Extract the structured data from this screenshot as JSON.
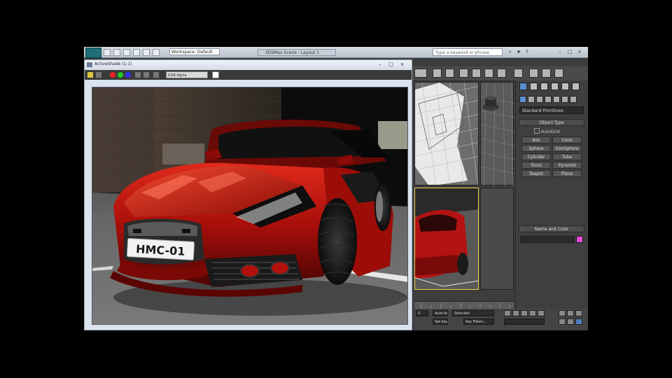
{
  "app": {
    "workspace": "Workspace: Default",
    "background_window_title": "3DSMax Scene - Layout 1",
    "search_placeholder": "Type a keyword or phrase"
  },
  "title_controls": {
    "minimize": "–",
    "maximize": "□",
    "close": "×"
  },
  "render_window": {
    "title": "ActiveShade (1:1)",
    "channel": "RGB Alpha",
    "license_plate": "HMC-01"
  },
  "command_panel": {
    "category": "Standard Primitives",
    "object_type_header": "Object Type",
    "autogrid": "AutoGrid",
    "buttons": [
      "Box",
      "Cone",
      "Sphere",
      "GeoSphere",
      "Cylinder",
      "Tube",
      "Torus",
      "Pyramid",
      "Teapot",
      "Plane"
    ],
    "name_color_header": "Name and Color",
    "rollout_minus": "-"
  },
  "status": {
    "selection": "Selected",
    "key_filters": "Key Filters...",
    "set_key": "Set Key",
    "auto_key": "Auto Key",
    "frame": "0"
  },
  "colors": {
    "name_color_swatch": "#e64ad9",
    "viewport_active_border": "#f0d24a"
  }
}
